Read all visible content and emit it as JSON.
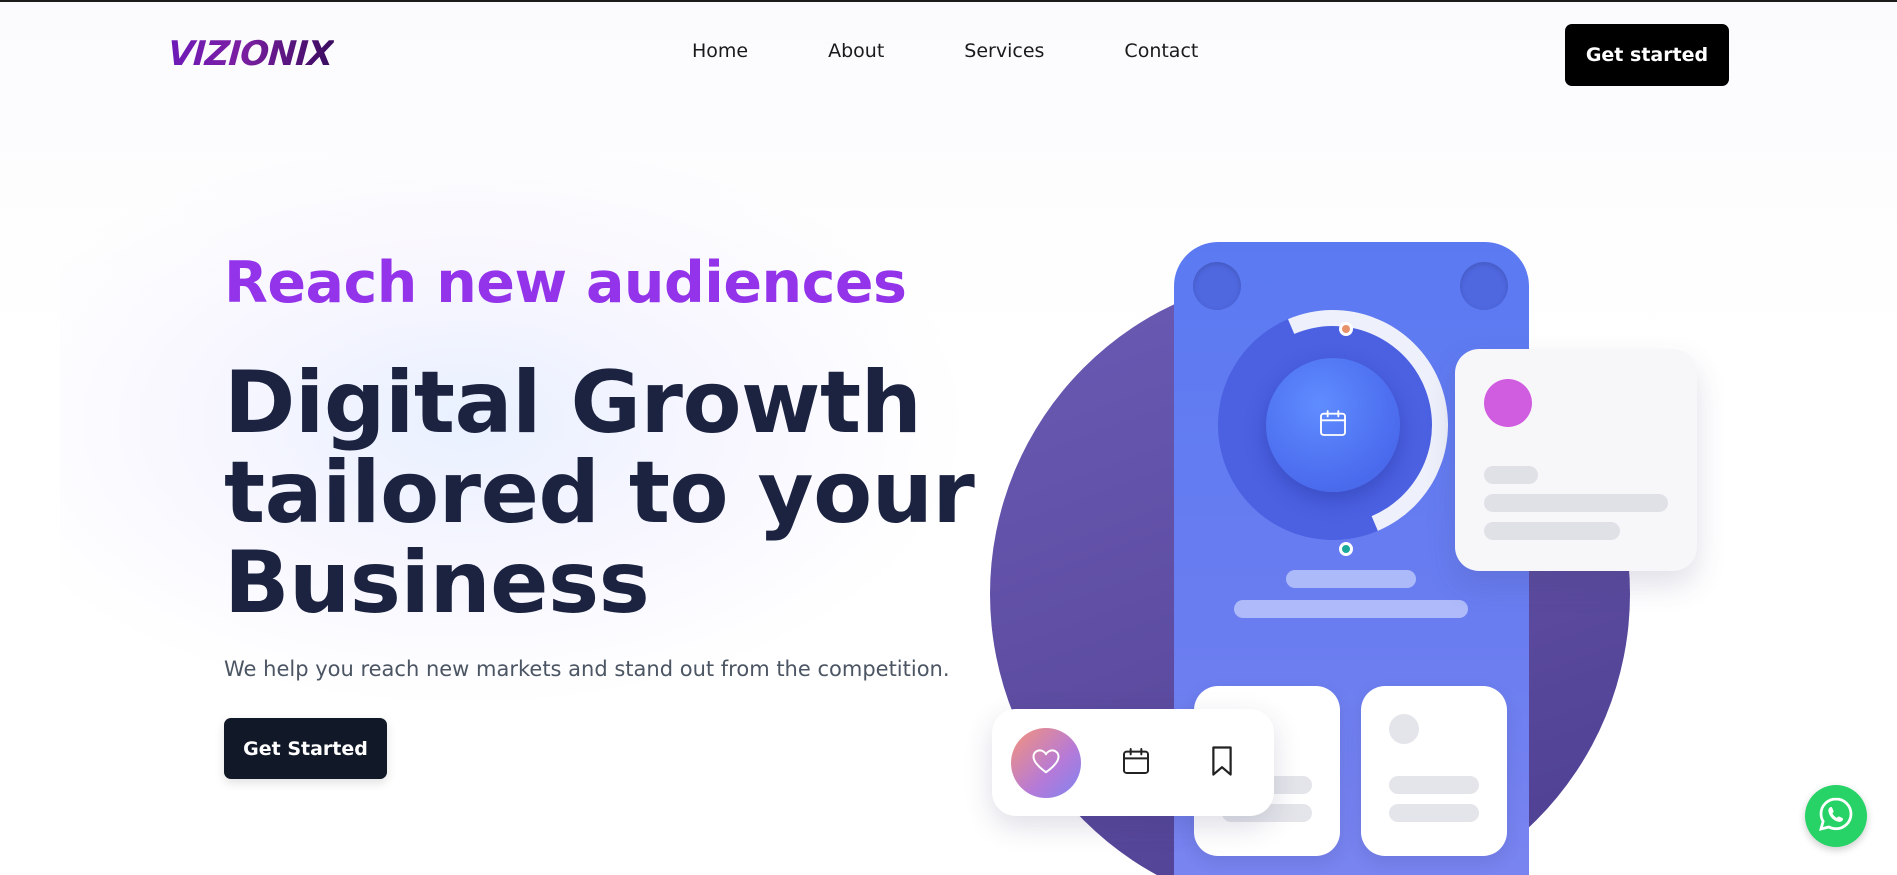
{
  "brand": {
    "logo_text": "VIZIONIX",
    "accent": "#9333ea",
    "dark": "#1b2340"
  },
  "nav": {
    "links": [
      "Home",
      "About",
      "Services",
      "Contact"
    ],
    "cta": "Get started"
  },
  "hero": {
    "eyebrow": "Reach new audiences",
    "headline_lines": [
      "Digital Growth",
      "tailored to your",
      "Business"
    ],
    "subtext": "We help you reach new markets and stand out from the competition.",
    "cta": "Get Started"
  },
  "illustration": {
    "icons": [
      "calendar-icon",
      "heart-icon",
      "calendar-icon",
      "bookmark-icon"
    ],
    "colors": {
      "circle": "#5b4a9e",
      "phone": "#5b7af2",
      "card_dot": "#d05ce0"
    }
  },
  "floating": {
    "icon": "whatsapp-icon",
    "color": "#27d366"
  }
}
